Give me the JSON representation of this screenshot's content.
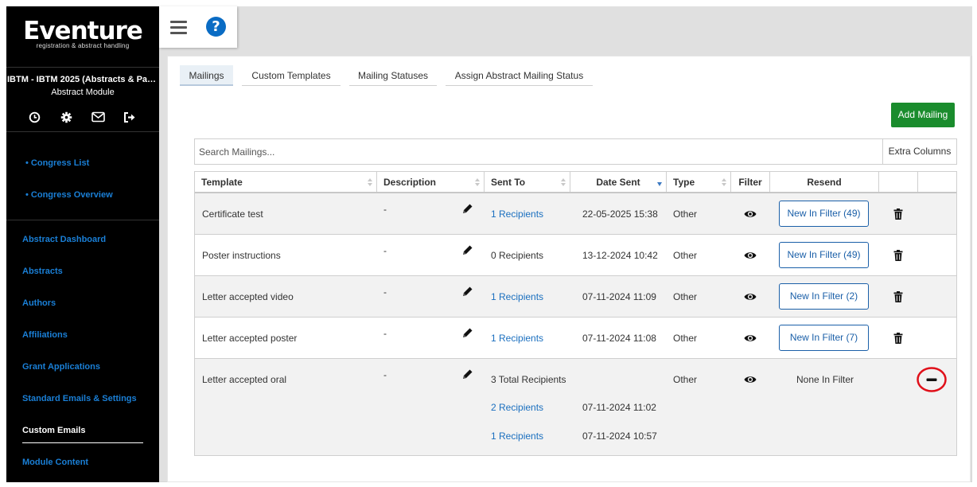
{
  "app": {
    "logo_main": "Eventure",
    "logo_sub": "registration & abstract handling",
    "congress_name": "IBTM - IBTM 2025 (Abstracts & Papers)",
    "module_name": "Abstract Module"
  },
  "sidebar": {
    "icons": [
      "clock-icon",
      "gear-icon",
      "envelope-icon",
      "logout-icon"
    ],
    "sub_links": [
      "• Congress List",
      "• Congress Overview"
    ],
    "items": [
      {
        "label": "Abstract Dashboard"
      },
      {
        "label": "Abstracts"
      },
      {
        "label": "Authors"
      },
      {
        "label": "Affiliations"
      },
      {
        "label": "Grant Applications"
      },
      {
        "label": "Standard Emails & Settings"
      },
      {
        "label": "Custom Emails",
        "active": true
      },
      {
        "label": "Module Content"
      }
    ]
  },
  "header": {
    "menu_icon": "hamburger-icon",
    "help_label": "?"
  },
  "tabs": [
    {
      "label": "Mailings",
      "active": true
    },
    {
      "label": "Custom Templates"
    },
    {
      "label": "Mailing Statuses"
    },
    {
      "label": "Assign Abstract Mailing Status"
    }
  ],
  "toolbar": {
    "add_label": "Add Mailing",
    "search_placeholder": "Search Mailings...",
    "extra_columns_label": "Extra Columns"
  },
  "table": {
    "columns": [
      "Template",
      "Description",
      "Sent To",
      "Date Sent",
      "Type",
      "Filter",
      "Resend",
      "",
      ""
    ],
    "rows": [
      {
        "template": "Certificate test",
        "description": "-",
        "sent_to": "1 Recipients",
        "sent_to_link": true,
        "date": "22-05-2025 15:38",
        "type": "Other",
        "resend": "New In Filter (49)"
      },
      {
        "template": "Poster instructions",
        "description": "-",
        "sent_to": "0 Recipients",
        "sent_to_link": false,
        "date": "13-12-2024 10:42",
        "type": "Other",
        "resend": "New In Filter (49)"
      },
      {
        "template": "Letter accepted video",
        "description": "-",
        "sent_to": "1 Recipients",
        "sent_to_link": true,
        "date": "07-11-2024 11:09",
        "type": "Other",
        "resend": "New In Filter (2)"
      },
      {
        "template": "Letter accepted poster",
        "description": "-",
        "sent_to": "1 Recipients",
        "sent_to_link": true,
        "date": "07-11-2024 11:08",
        "type": "Other",
        "resend": "New In Filter (7)"
      },
      {
        "template": "Letter accepted oral",
        "description": "-",
        "sent_to": "3 Total Recipients",
        "type": "Other",
        "resend": "None In Filter",
        "sub_rows": [
          {
            "sent_to": "2 Recipients",
            "date": "07-11-2024 11:02"
          },
          {
            "sent_to": "1 Recipients",
            "date": "07-11-2024 10:57"
          }
        ]
      }
    ]
  },
  "colors": {
    "sidebar_bg": "#000000",
    "link": "#1a7fd6",
    "add_button": "#1a8c2d",
    "help_button": "#0a6cc4",
    "highlight_circle": "#e0101a"
  }
}
